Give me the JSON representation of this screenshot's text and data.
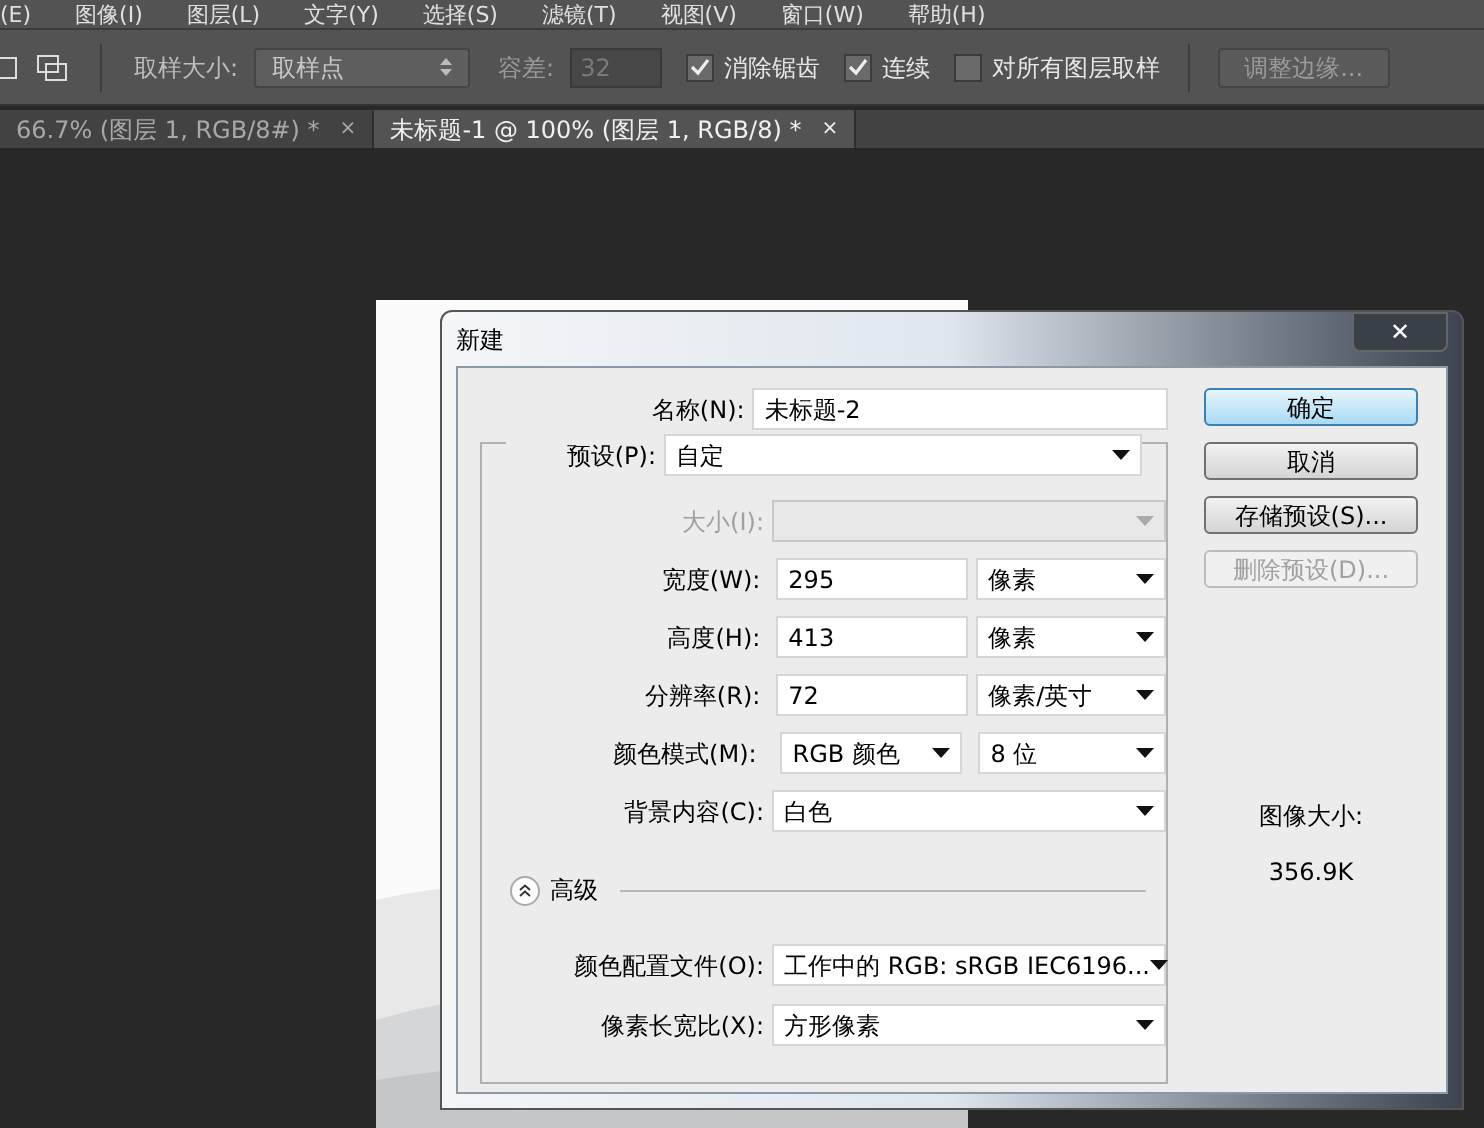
{
  "menu": [
    "(E)",
    "图像(I)",
    "图层(L)",
    "文字(Y)",
    "选择(S)",
    "滤镜(T)",
    "视图(V)",
    "窗口(W)",
    "帮助(H)"
  ],
  "options_bar": {
    "sample_size_label": "取样大小:",
    "sample_size": "取样点",
    "tolerance_label": "容差:",
    "tolerance": "32",
    "checkboxes": [
      {
        "label": "消除锯齿",
        "checked": true
      },
      {
        "label": "连续",
        "checked": true
      },
      {
        "label": "对所有图层取样",
        "checked": false
      }
    ],
    "refine_button": "调整边缘..."
  },
  "doc_tabs": [
    {
      "label": "66.7% (图层 1, RGB/8#) *",
      "close": "×",
      "selected": false
    },
    {
      "label": "未标题-1 @ 100% (图层 1, RGB/8) *",
      "close": "×",
      "selected": true
    }
  ],
  "dialog": {
    "title": "新建",
    "close": "✕",
    "name_label": "名称(N):",
    "name": "未标题-2",
    "preset_label": "预设(P):",
    "preset": "自定",
    "rows": [
      {
        "kind": "disabled",
        "label": "大小(I):"
      },
      {
        "kind": "unit",
        "label": "宽度(W):",
        "value": "295",
        "unit": "像素"
      },
      {
        "kind": "unit",
        "label": "高度(H):",
        "value": "413",
        "unit": "像素"
      },
      {
        "kind": "unit",
        "label": "分辨率(R):",
        "value": "72",
        "unit": "像素/英寸"
      },
      {
        "kind": "pair",
        "label": "颜色模式(M):",
        "value": "RGB 颜色",
        "unit": "8 位"
      },
      {
        "kind": "select",
        "label": "背景内容(C):",
        "value": "白色"
      }
    ],
    "advanced": {
      "label": "高级",
      "expanded": true,
      "rows": [
        {
          "label": "颜色配置文件(O):",
          "value": "工作中的 RGB: sRGB IEC6196..."
        },
        {
          "label": "像素长宽比(X):",
          "value": "方形像素"
        }
      ]
    },
    "buttons": [
      {
        "label": "确定",
        "kind": "default",
        "disabled": false
      },
      {
        "label": "取消",
        "kind": "normal",
        "disabled": false
      },
      {
        "label": "存储预设(S)...",
        "kind": "normal",
        "disabled": false
      },
      {
        "label": "删除预设(D)...",
        "kind": "normal",
        "disabled": true
      }
    ],
    "image_size_label": "图像大小:",
    "image_size": "356.9K"
  }
}
